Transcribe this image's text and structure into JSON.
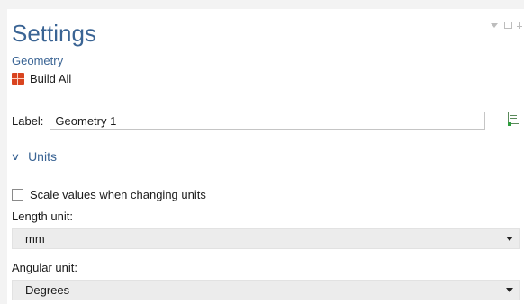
{
  "header": {
    "title": "Settings",
    "subtitle": "Geometry",
    "build_all_label": "Build All"
  },
  "label_field": {
    "label": "Label:",
    "value": "Geometry 1"
  },
  "units_section": {
    "title": "Units",
    "scale_checkbox_label": "Scale values when changing units",
    "scale_checked": false,
    "length_label": "Length unit:",
    "length_value": "mm",
    "angular_label": "Angular unit:",
    "angular_value": "Degrees"
  },
  "colors": {
    "accent": "#3a6494",
    "build_icon": "#d9441f"
  },
  "icons": [
    "minimize-icon",
    "maximize-icon",
    "pin-icon",
    "build-all-icon",
    "label-edit-icon",
    "chevron-down-icon",
    "dropdown-arrow-icon"
  ]
}
